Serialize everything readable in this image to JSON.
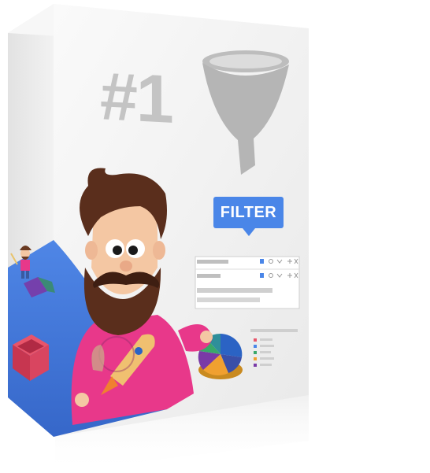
{
  "box": {
    "rank_label": "#1",
    "badge_label": "FILTER"
  },
  "colors": {
    "box_front": "#f1f1f1",
    "box_side": "#e4e4e4",
    "accent_blue": "#4a86e8",
    "mascot_shirt": "#e8388a",
    "mascot_beard": "#5a2e1c"
  },
  "icons": [
    "funnel-icon",
    "mascot-character",
    "rocket-icon",
    "pie-chart-icon",
    "gift-box-icon",
    "small-mascot-icon"
  ]
}
